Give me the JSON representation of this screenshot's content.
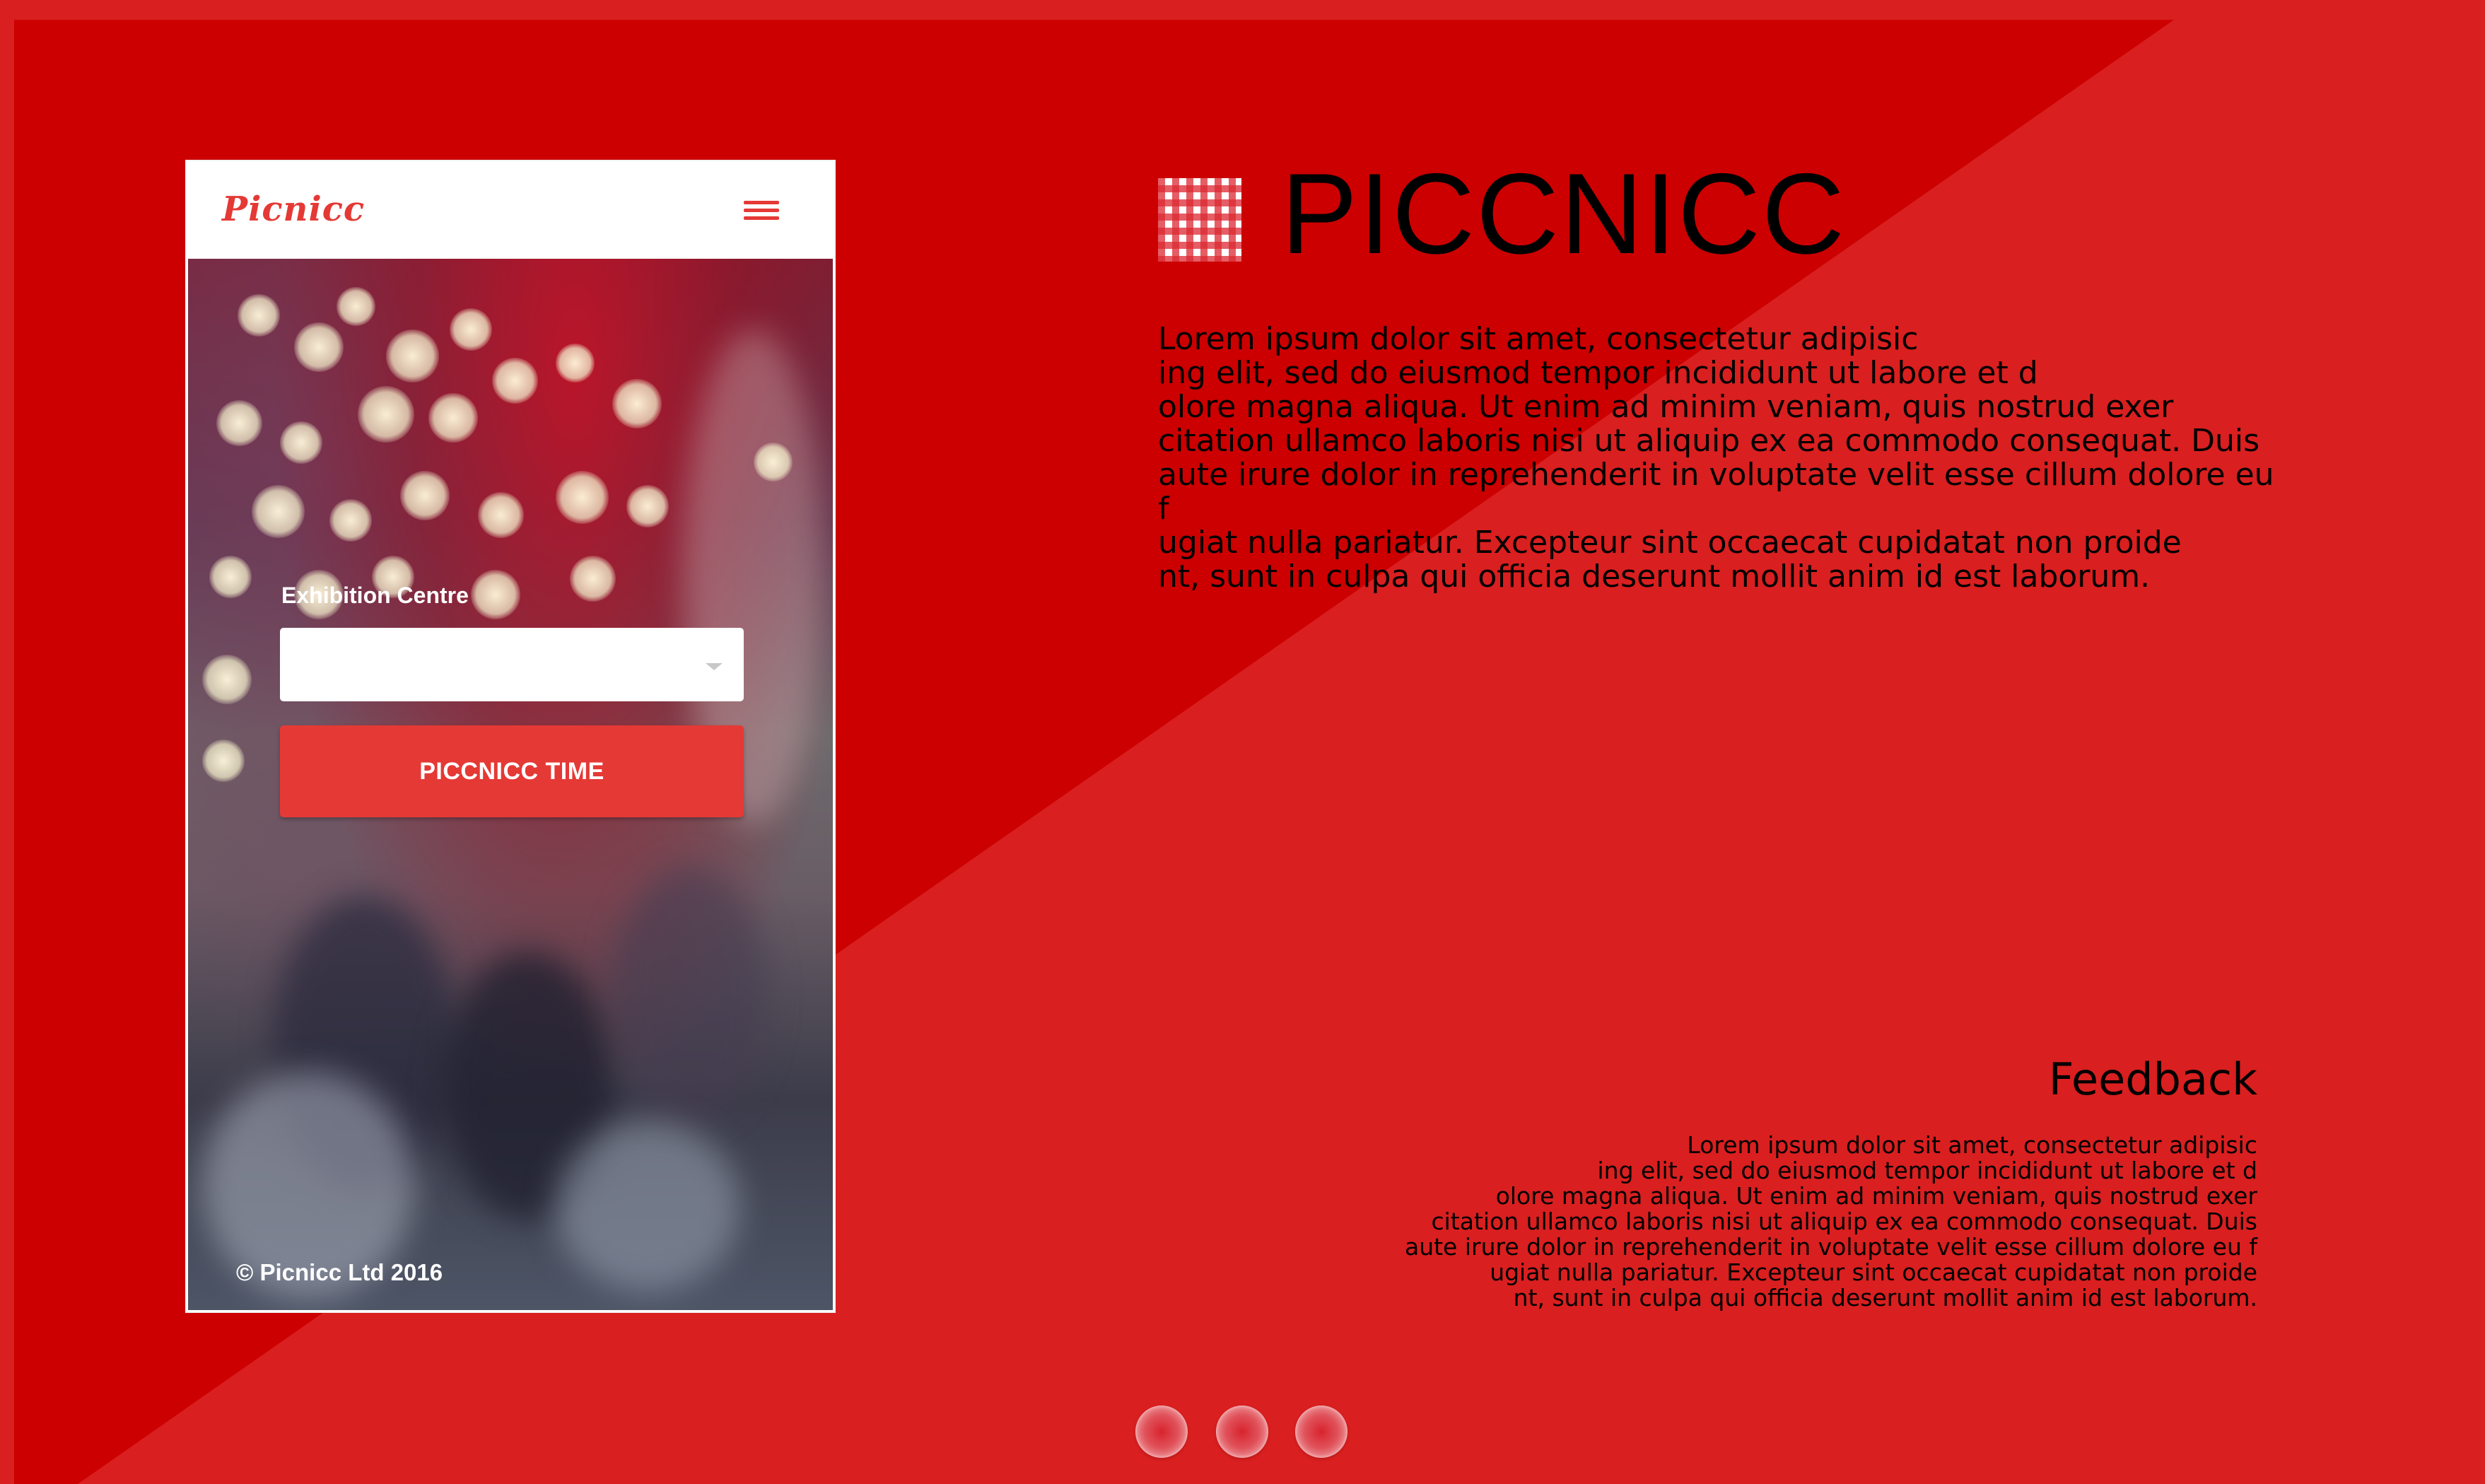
{
  "theme": {
    "background": "#d91f1f",
    "diagonal_panel": "#cc0000",
    "accent": "#e53935",
    "text": "#000000"
  },
  "phone": {
    "logo": "Picnicc",
    "menu_icon": "hamburger-menu-icon",
    "field_label": "Exhibition Centre",
    "select_value": "",
    "button_label": "PICCNICC TIME",
    "footer": "© Picnicc Ltd 2016"
  },
  "brand": {
    "icon": "gingham-checkered-icon",
    "title": "PICCNICC"
  },
  "intro": {
    "text": "Lorem ipsum dolor sit amet, consectetur adipisic\ning elit, sed do eiusmod tempor incididunt ut labore et d\nolore magna aliqua. Ut enim ad minim veniam, quis nostrud exer\ncitation ullamco laboris nisi ut aliquip ex ea commodo consequat. Duis\n aute irure dolor in reprehenderit in voluptate velit esse cillum dolore eu f\nugiat nulla pariatur. Excepteur sint occaecat cupidatat non proide\nnt, sunt in culpa qui officia deserunt mollit anim id est laborum."
  },
  "feedback": {
    "title": "Feedback",
    "text": "Lorem ipsum dolor sit amet, consectetur adipisic\ning elit, sed do eiusmod tempor incididunt ut labore et d\nolore magna aliqua. Ut enim ad minim veniam, quis nostrud exer\ncitation ullamco laboris nisi ut aliquip ex ea commodo consequat. Duis\naute irure dolor in reprehenderit in voluptate velit esse cillum dolore eu f\nugiat nulla pariatur. Excepteur sint occaecat cupidatat non proide\nnt, sunt in culpa qui officia deserunt mollit anim id est laborum."
  },
  "pager": {
    "count": 3
  }
}
